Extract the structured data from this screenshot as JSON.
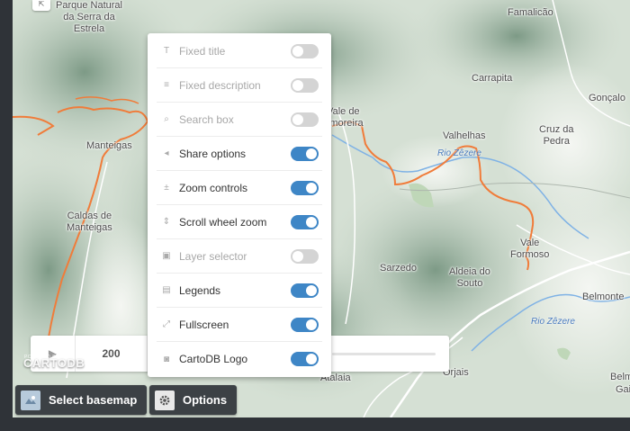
{
  "map": {
    "places": [
      {
        "id": "parque",
        "text": "Parque Natural\nda Serra da\nEstrela"
      },
      {
        "id": "famalicao",
        "text": "Famalicão"
      },
      {
        "id": "carrapita",
        "text": "Carrapita"
      },
      {
        "id": "goncalo",
        "text": "Gonçalo"
      },
      {
        "id": "vale-amoreira",
        "text": "Vale de\nAmoreira"
      },
      {
        "id": "valhelhas",
        "text": "Valhelhas"
      },
      {
        "id": "cruz-pedra",
        "text": "Cruz da\nPedra"
      },
      {
        "id": "manteigas",
        "text": "Manteigas"
      },
      {
        "id": "caldas",
        "text": "Caldas de\nManteigas"
      },
      {
        "id": "sarzedo",
        "text": "Sarzedo"
      },
      {
        "id": "aldeia-souto",
        "text": "Aldeia do\nSouto"
      },
      {
        "id": "vale-formoso",
        "text": "Vale\nFormoso"
      },
      {
        "id": "belmonte",
        "text": "Belmonte"
      },
      {
        "id": "orjais",
        "text": "Orjais"
      },
      {
        "id": "atalaia",
        "text": "Atalaia"
      },
      {
        "id": "gaia",
        "text": "Gaia"
      },
      {
        "id": "belmonte-r",
        "text": "Belm"
      }
    ],
    "rivers": [
      {
        "id": "rio-zezere-1",
        "text": "Rio Zêzere"
      },
      {
        "id": "rio-zezere-2",
        "text": "Rio Zêzere"
      }
    ],
    "colors": {
      "route": "#f07c3a",
      "river": "#7fb2e5",
      "terrain": "#8aa290"
    }
  },
  "timeline": {
    "play_icon": "play-icon",
    "step_value": "200"
  },
  "branding": {
    "logo_text": "CARTODB",
    "powered_by": "POWERED BY"
  },
  "buttons": {
    "basemap_label": "Select basemap",
    "options_label": "Options"
  },
  "options": {
    "items": [
      {
        "label": "Fixed title",
        "enabled": false,
        "icon": "title-icon"
      },
      {
        "label": "Fixed description",
        "enabled": false,
        "icon": "description-icon"
      },
      {
        "label": "Search box",
        "enabled": false,
        "icon": "search-icon"
      },
      {
        "label": "Share options",
        "enabled": true,
        "icon": "share-icon"
      },
      {
        "label": "Zoom controls",
        "enabled": true,
        "icon": "zoom-icon"
      },
      {
        "label": "Scroll wheel zoom",
        "enabled": true,
        "icon": "scroll-icon"
      },
      {
        "label": "Layer selector",
        "enabled": false,
        "icon": "layers-icon"
      },
      {
        "label": "Legends",
        "enabled": true,
        "icon": "legend-icon"
      },
      {
        "label": "Fullscreen",
        "enabled": true,
        "icon": "fullscreen-icon"
      },
      {
        "label": "CartoDB Logo",
        "enabled": true,
        "icon": "logo-icon"
      }
    ],
    "accent_color": "#3e86c6"
  }
}
